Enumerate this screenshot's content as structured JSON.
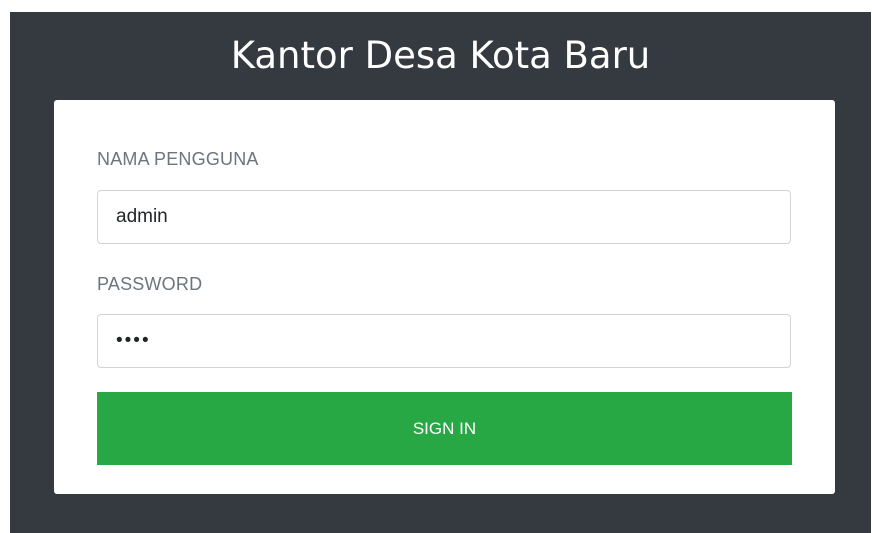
{
  "app": {
    "title": "Kantor Desa Kota Baru"
  },
  "form": {
    "username_label": "NAMA PENGGUNA",
    "username_value": "admin",
    "password_label": "PASSWORD",
    "password_value": "••••",
    "submit_label": "SIGN IN"
  },
  "colors": {
    "panel_background": "#343a40",
    "card_background": "#ffffff",
    "button_background": "#28a745",
    "button_text": "#ffffff",
    "label_text": "#6c757d"
  }
}
